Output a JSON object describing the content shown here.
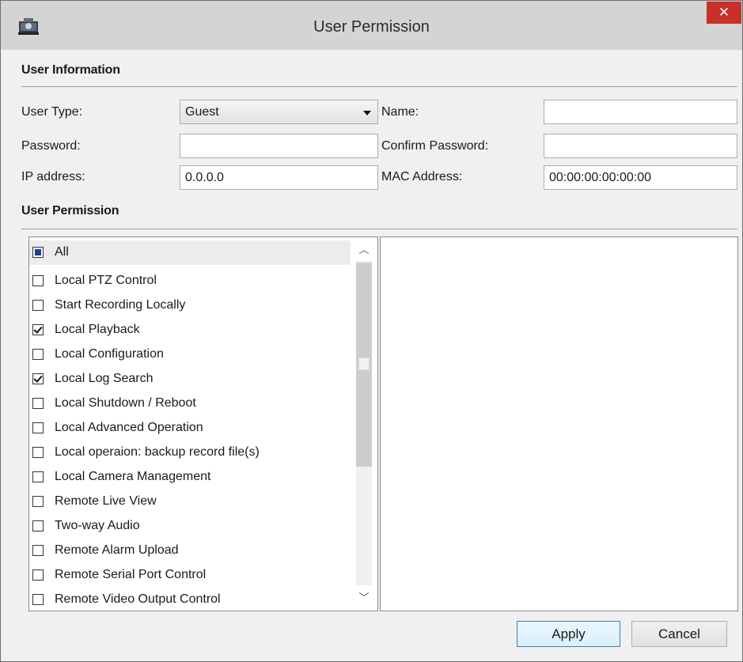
{
  "window": {
    "title": "User Permission",
    "close_label": "✕"
  },
  "user_info": {
    "section_title": "User Information",
    "user_type_label": "User Type:",
    "user_type_value": "Guest",
    "name_label": "Name:",
    "name_value": "",
    "password_label": "Password:",
    "password_value": "",
    "confirm_password_label": "Confirm Password:",
    "confirm_password_value": "",
    "ip_label": "IP address:",
    "ip_value": "0.0.0.0",
    "mac_label": "MAC Address:",
    "mac_value": "00:00:00:00:00:00"
  },
  "permissions": {
    "section_title": "User Permission",
    "all": {
      "label": "All",
      "state": "partial"
    },
    "items": [
      {
        "label": "Local PTZ Control",
        "checked": false
      },
      {
        "label": "Start Recording Locally",
        "checked": false
      },
      {
        "label": "Local Playback",
        "checked": true
      },
      {
        "label": "Local Configuration",
        "checked": false
      },
      {
        "label": "Local Log Search",
        "checked": true
      },
      {
        "label": "Local Shutdown / Reboot",
        "checked": false
      },
      {
        "label": "Local Advanced Operation",
        "checked": false
      },
      {
        "label": "Local operaion: backup record file(s)",
        "checked": false
      },
      {
        "label": "Local Camera Management",
        "checked": false
      },
      {
        "label": "Remote Live View",
        "checked": false
      },
      {
        "label": "Two-way Audio",
        "checked": false
      },
      {
        "label": "Remote Alarm Upload",
        "checked": false
      },
      {
        "label": "Remote Serial Port Control",
        "checked": false
      },
      {
        "label": "Remote Video Output Control",
        "checked": false
      }
    ]
  },
  "buttons": {
    "apply": "Apply",
    "cancel": "Cancel"
  },
  "colors": {
    "close_button": "#c8302a",
    "partial_check": "#1f3e8f"
  }
}
